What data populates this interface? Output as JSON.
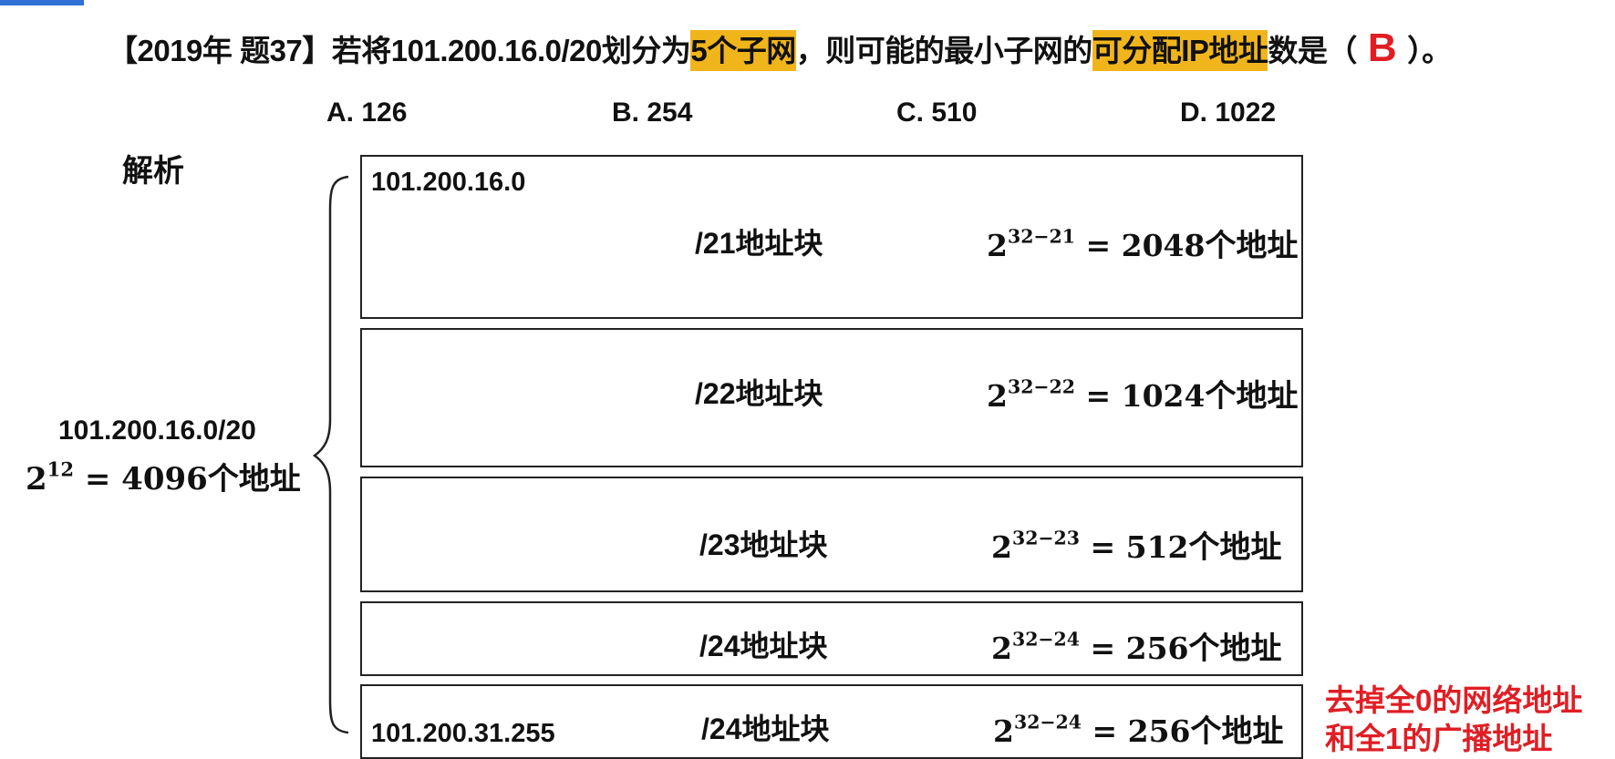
{
  "question": {
    "prefix": "【2019年 题37】若将101.200.16.0/20划分为",
    "highlight1": "5个子网",
    "middle": "，则可能的最小子网的",
    "highlight2": "可分配IP地址",
    "suffix": "数是（",
    "answer": "B",
    "end": "）。"
  },
  "options": [
    "A. 126",
    "B. 254",
    "C. 510",
    "D. 1022"
  ],
  "analysis_title": "解析",
  "whole": {
    "network": "101.200.16.0/20",
    "base": "2",
    "exp": "12",
    "equals": " = 4096",
    "unit": "个地址"
  },
  "blocks": [
    {
      "label": "/21地址块",
      "base": "2",
      "exp": "32−21",
      "equals": " = 2048",
      "unit": "个地址",
      "addr_top": "101.200.16.0",
      "addr_bottom": ""
    },
    {
      "label": "/22地址块",
      "base": "2",
      "exp": "32−22",
      "equals": " = 1024",
      "unit": "个地址",
      "addr_top": "",
      "addr_bottom": ""
    },
    {
      "label": "/23地址块",
      "base": "2",
      "exp": "32−23",
      "equals": " = 512",
      "unit": "个地址",
      "addr_top": "",
      "addr_bottom": ""
    },
    {
      "label": "/24地址块",
      "base": "2",
      "exp": "32−24",
      "equals": " = 256",
      "unit": "个地址",
      "addr_top": "",
      "addr_bottom": ""
    },
    {
      "label": "/24地址块",
      "base": "2",
      "exp": "32−24",
      "equals": " = 256",
      "unit": "个地址",
      "addr_top": "",
      "addr_bottom": "101.200.31.255"
    }
  ],
  "note": [
    "去掉全0的网络地址",
    "和全1的广播地址"
  ],
  "colors": {
    "highlight": "#f1b51c",
    "answer": "#e01e24",
    "note": "#e01e24",
    "accent_tab": "#2f6fd6"
  }
}
